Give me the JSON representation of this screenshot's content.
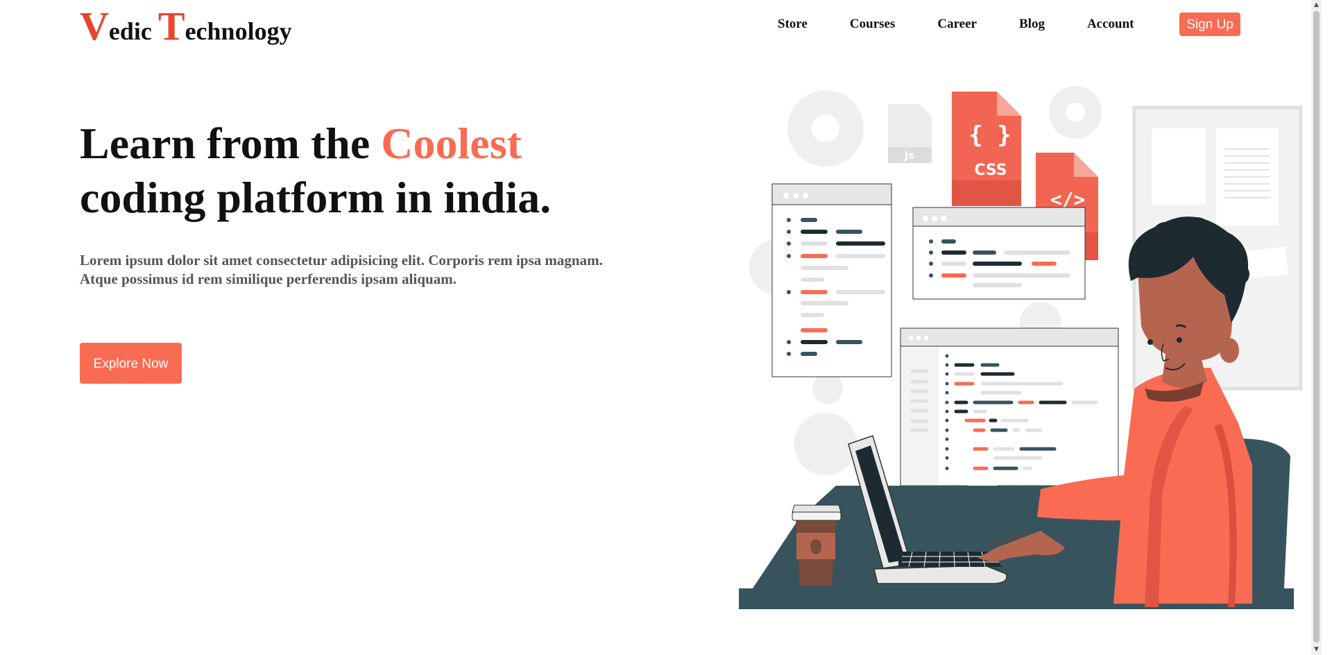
{
  "brand": {
    "cap1": "V",
    "rest1": "edic ",
    "cap2": "T",
    "rest2": "echnology"
  },
  "nav": {
    "items": [
      "Store",
      "Courses",
      "Career",
      "Blog",
      "Account"
    ],
    "signup": "Sign Up"
  },
  "hero": {
    "title_part1": "Learn from the ",
    "title_accent": "Coolest",
    "title_line2": "coding platform in india.",
    "subtitle": "Lorem ipsum dolor sit amet consectetur adipisicing elit. Corporis rem ipsa magnam. Atque possimus id rem similique perferendis ipsam aliquam.",
    "cta": "Explore Now"
  },
  "illustration": {
    "css_label": "CSS",
    "html_label": "</>",
    "js_label": "Js"
  },
  "colors": {
    "accent": "#fa6b53",
    "brand_red": "#e8452c",
    "dark_teal": "#37545e"
  }
}
